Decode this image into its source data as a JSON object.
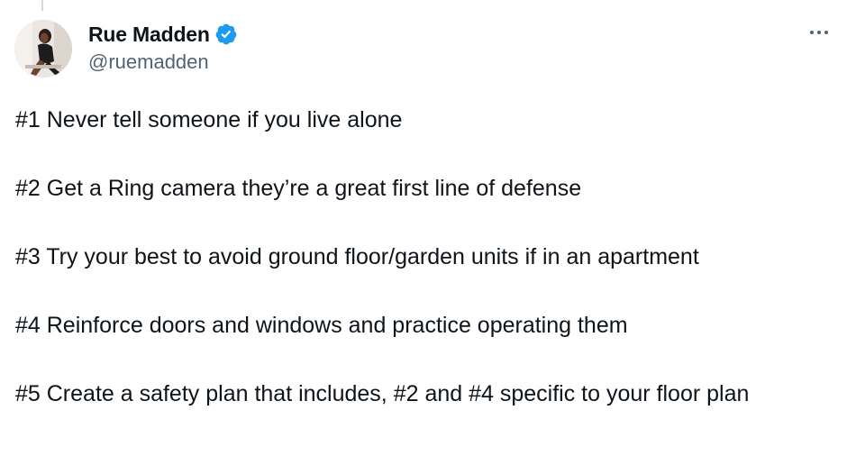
{
  "author": {
    "display_name": "Rue Madden",
    "handle": "@ruemadden",
    "verified": true,
    "verified_color": "#1d9bf0",
    "avatar_icon": "profile-avatar"
  },
  "menu": {
    "icon": "more-options-icon"
  },
  "tweet": {
    "lines": [
      "#1 Never tell someone if you live alone",
      "#2 Get a Ring camera they’re a great first line of defense",
      "#3 Try your best to avoid ground floor/garden units if in an apartment",
      "#4 Reinforce doors and windows and practice operating them",
      "#5 Create a safety plan that includes, #2 and #4 specific to your floor plan"
    ]
  },
  "colors": {
    "text_primary": "#0f1419",
    "text_secondary": "#536471",
    "thread_line": "#cfd9de"
  }
}
